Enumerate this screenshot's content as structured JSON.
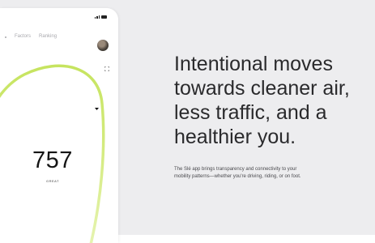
{
  "phone": {
    "tabs": [
      "Factors",
      "Ranking"
    ],
    "score": {
      "value": "757",
      "label": "GREAT"
    },
    "ring_color": "#d6ec84"
  },
  "hero": {
    "headline": "Intentional moves towards cleaner air, less traffic, and a healthier you.",
    "body": "The Slé app brings transparency and connectivity to your mobility patterns—whether you're driving, riding, or on foot."
  },
  "colors": {
    "background": "#ededef",
    "phone_surface": "#ffffff",
    "text_primary": "#2a2a2c"
  },
  "icons": [
    "signal-icon",
    "battery-icon",
    "expand-icon",
    "caret-down-icon",
    "avatar"
  ]
}
